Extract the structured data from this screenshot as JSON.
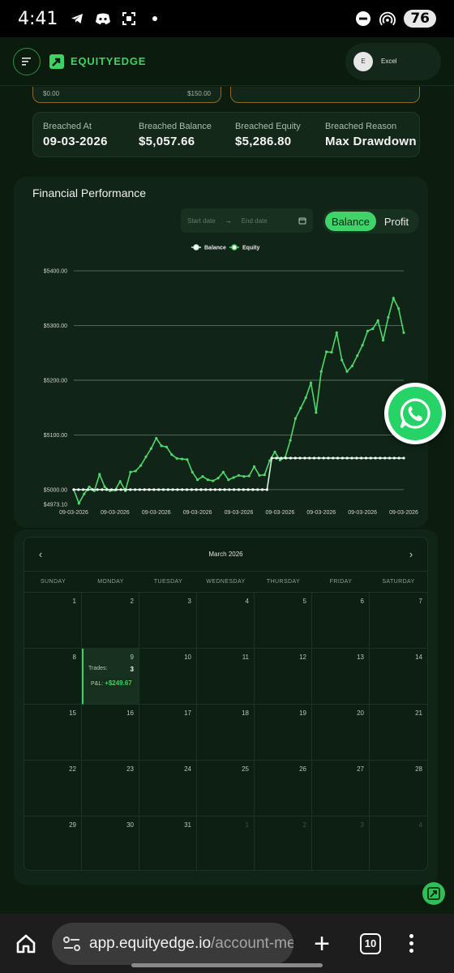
{
  "status_bar": {
    "time": "4:41",
    "battery": "76",
    "icons": [
      "telegram-icon",
      "discord-icon",
      "screenshot-icon",
      "dot-icon",
      "dnd-icon",
      "hotspot-icon"
    ]
  },
  "header": {
    "brand": "EQUITYEDGE",
    "account_initial": "E",
    "account_name": "Excel"
  },
  "progress_cards": {
    "left_min": "$0.00",
    "left_max": "$150.00"
  },
  "breach": {
    "items": [
      {
        "label": "Breached At",
        "value": "09-03-2026"
      },
      {
        "label": "Breached Balance",
        "value": "$5,057.66"
      },
      {
        "label": "Breached Equity",
        "value": "$5,286.80"
      },
      {
        "label": "Breached Reason",
        "value": "Max Drawdown"
      }
    ]
  },
  "performance": {
    "title": "Financial Performance",
    "start_placeholder": "Start date",
    "end_placeholder": "End date",
    "range_arrow": "→",
    "toggle_active": "Balance",
    "toggle_inactive": "Profit"
  },
  "chart_data": {
    "type": "line",
    "legend": [
      "Balance",
      "Equity"
    ],
    "legend_position": "top-center",
    "ytick_labels": [
      "$5400.00",
      "$5300.00",
      "$5200.00",
      "$5100.00",
      "$5000.00",
      "$4973.10"
    ],
    "yticks": [
      5400,
      5300,
      5200,
      5100,
      5000,
      4973.1
    ],
    "ylim": [
      4973.1,
      5400
    ],
    "xtick_labels": [
      "09-03-2026",
      "09-03-2026",
      "09-03-2026",
      "09-03-2026",
      "09-03-2026",
      "09-03-2026",
      "09-03-2026",
      "09-03-2026",
      "09-03-2026"
    ],
    "grid": true,
    "colors": {
      "balance": "#c9f7d4",
      "equity": "#4fd86b"
    },
    "series": [
      {
        "name": "Balance",
        "values": [
          5000,
          5000,
          5000,
          5000,
          5000,
          5000,
          5000,
          5000,
          5000,
          5000,
          5000,
          5000,
          5000,
          5000,
          5000,
          5000,
          5000,
          5000,
          5000,
          5000,
          5000,
          5000,
          5000,
          5000,
          5000,
          5000,
          5000,
          5000,
          5000,
          5000,
          5000,
          5000,
          5000,
          5000,
          5000,
          5000,
          5000,
          5000,
          5000,
          5000,
          5000,
          5000,
          5057.66,
          5057.66,
          5057.66,
          5057.66,
          5057.66,
          5057.66,
          5057.66,
          5057.66,
          5057.66,
          5057.66,
          5057.66,
          5057.66,
          5057.66,
          5057.66,
          5057.66,
          5057.66,
          5057.66,
          5057.66,
          5057.66,
          5057.66,
          5057.66,
          5057.66,
          5057.66,
          5057.66,
          5057.66,
          5057.66,
          5057.66,
          5057.66,
          5057.66
        ]
      },
      {
        "name": "Equity",
        "values": [
          5000,
          4975,
          4992,
          5005,
          4998,
          5028,
          5005,
          4998,
          4999,
          5015,
          4998,
          5032,
          5034,
          5044,
          5060,
          5075,
          5094,
          5080,
          5078,
          5064,
          5057,
          5056,
          5055,
          5032,
          5018,
          5024,
          5018,
          5016,
          5021,
          5032,
          5018,
          5022,
          5026,
          5024,
          5025,
          5042,
          5026,
          5027,
          5053,
          5069,
          5054,
          5059,
          5090,
          5130,
          5149,
          5168,
          5195,
          5141,
          5216,
          5252,
          5251,
          5287,
          5237,
          5216,
          5226,
          5245,
          5264,
          5290,
          5294,
          5309,
          5273,
          5315,
          5350,
          5331,
          5287
        ]
      }
    ]
  },
  "calendar": {
    "month": "March 2026",
    "prev": "‹",
    "next": "›",
    "weekdays": [
      "SUNDAY",
      "MONDAY",
      "TUESDAY",
      "WEDNESDAY",
      "THURSDAY",
      "FRIDAY",
      "SATURDAY"
    ],
    "days": [
      "1",
      "2",
      "3",
      "4",
      "5",
      "6",
      "7",
      "8",
      "9",
      "10",
      "11",
      "12",
      "13",
      "14",
      "15",
      "16",
      "17",
      "18",
      "19",
      "20",
      "21",
      "22",
      "23",
      "24",
      "25",
      "26",
      "27",
      "28",
      "29",
      "30",
      "31",
      "1",
      "2",
      "3",
      "4"
    ],
    "active_day": {
      "trades_label": "Trades:",
      "trades": "3",
      "pnl_label": "P&L:",
      "pnl": "+$249.67"
    }
  },
  "browser": {
    "url_host": "app.equityedge.io",
    "url_path": "/account-met",
    "tab_count": "10"
  }
}
